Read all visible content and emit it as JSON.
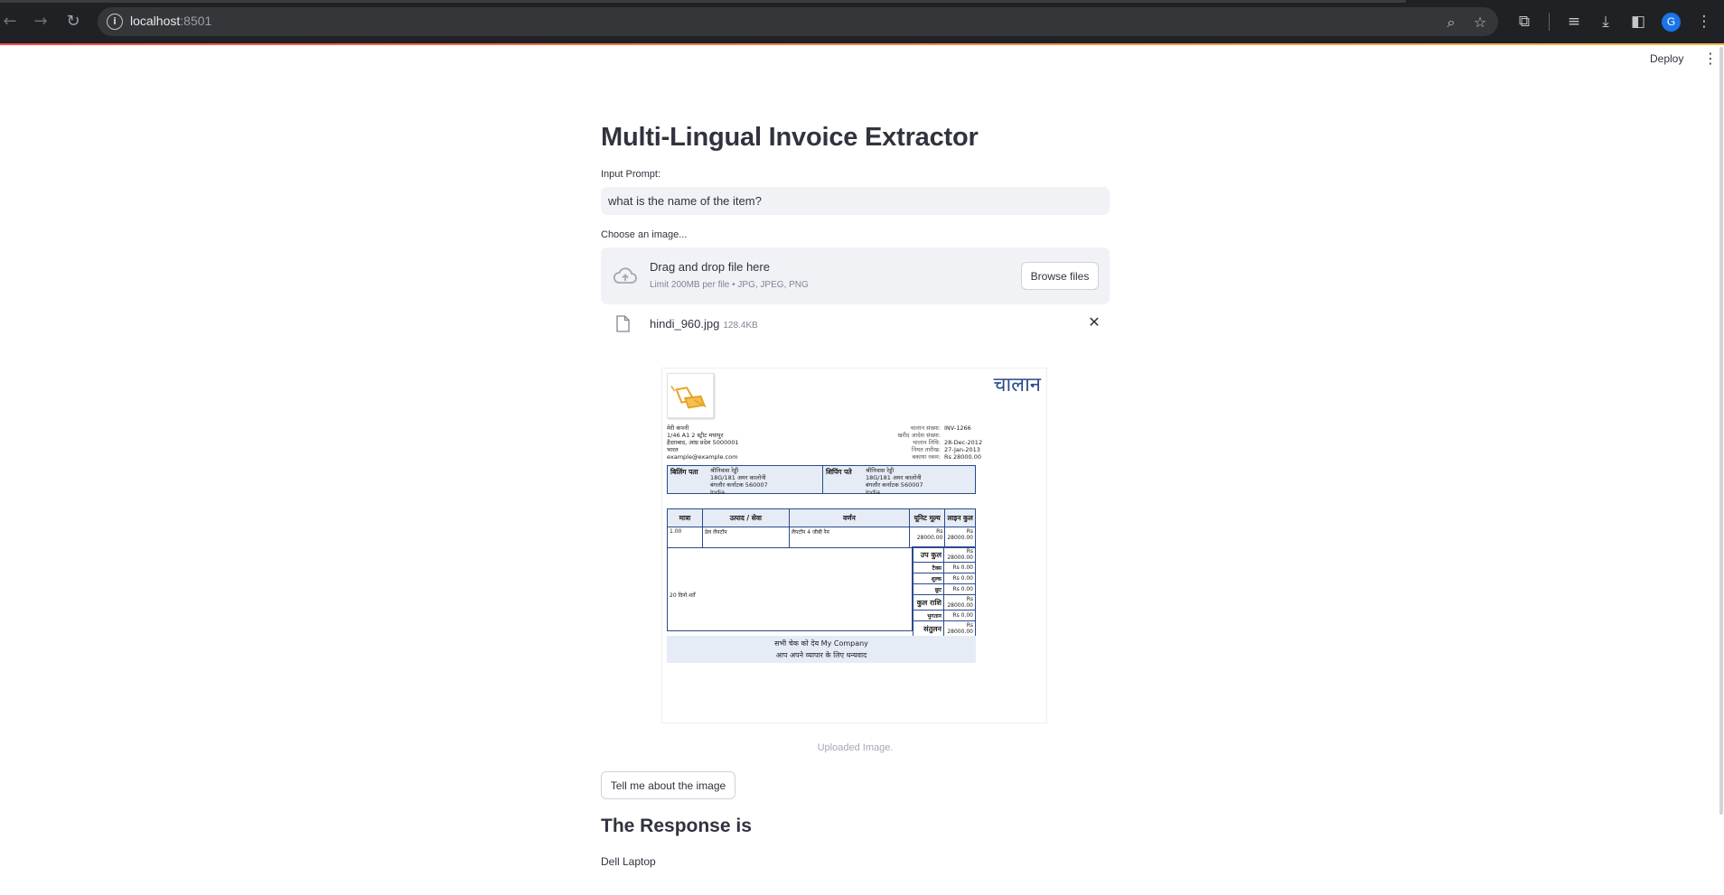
{
  "browser": {
    "url_host": "localhost",
    "url_port": ":8501",
    "profile_initial": "G",
    "icons": [
      "back-icon",
      "forward-icon",
      "reload-icon",
      "site-info-icon",
      "zoom-icon",
      "bookmark-star-icon",
      "extensions-icon",
      "media-icon",
      "download-icon",
      "side-panel-icon",
      "profile-avatar",
      "menu-icon"
    ]
  },
  "app_header": {
    "deploy_label": "Deploy",
    "menu_icon": "kebab-menu-icon"
  },
  "main": {
    "title": "Multi-Lingual Invoice Extractor",
    "input_label": "Input Prompt:",
    "input_value": "what is the name of the item?",
    "uploader_label": "Choose an image...",
    "dropzone_title": "Drag and drop file here",
    "dropzone_subtitle": "Limit 200MB per file • JPG, JPEG, PNG",
    "browse_label": "Browse files",
    "file_name": "hindi_960.jpg",
    "file_size": "128.4KB",
    "caption": "Uploaded Image.",
    "submit_label": "Tell me about the image",
    "response_title": "The Response is",
    "response_text": "Dell Laptop"
  },
  "invoice": {
    "title": "चालान",
    "company_lines": [
      "मेरी कंपनी",
      "1/46 A1 2 स्ट्रीट मधापुर",
      "हैदराबाद, आंध्र प्रदेश 5000001",
      "भारत",
      "example@example.com"
    ],
    "meta": [
      {
        "k": "चालान संख्या:",
        "v": "INV-1266"
      },
      {
        "k": "खरीद आदेश संख्या:",
        "v": ""
      },
      {
        "k": "चालान तिथि:",
        "v": "28-Dec-2012"
      },
      {
        "k": "नियत तारीख:",
        "v": "27-Jan-2013"
      },
      {
        "k": "बकाया रकम:",
        "v": "Rs 28000.00"
      }
    ],
    "billing_label": "बिलिंग पता",
    "billing_lines": [
      "श्रीनिवास रेड्डी",
      "18G/181 अमर कालोनी",
      "बंगलौर कर्नाटक 560007",
      "India"
    ],
    "shipping_label": "शिपिंग पते",
    "shipping_lines": [
      "श्रीनिवास रेड्डी",
      "18G/181 अमर कालोनी",
      "बंगलौर कर्नाटक 560007",
      "India"
    ],
    "columns": [
      "मात्रा",
      "उत्पाद / सेवा",
      "वर्णन",
      "यूनिट मूल्य",
      "लाइन कुल"
    ],
    "row": {
      "qty": "1.00",
      "product": "डेल लैपटॉप",
      "desc": "लैपटॉप 4 जीबी रैम",
      "unit": "Rs 28000.00",
      "total": "Rs 28000.00"
    },
    "terms": "20 दिनों शर्तें",
    "totals": [
      {
        "k": "उप कुल",
        "v": "Rs 28000.00",
        "big": true
      },
      {
        "k": "टैक्स",
        "v": "Rs 0.00",
        "big": false
      },
      {
        "k": "शुल्क",
        "v": "Rs 0.00",
        "big": false
      },
      {
        "k": "छूट",
        "v": "Rs 0.00",
        "big": false
      },
      {
        "k": "कुल राशि",
        "v": "Rs 28000.00",
        "big": true
      },
      {
        "k": "भुगतान",
        "v": "Rs 0.00",
        "big": false
      },
      {
        "k": "संतुलन",
        "v": "Rs 28000.00",
        "big": true
      }
    ],
    "footer_line1": "सभी चेक को देय My Company",
    "footer_line2": "आप अपने व्यापार के लिए धन्यवाद"
  }
}
